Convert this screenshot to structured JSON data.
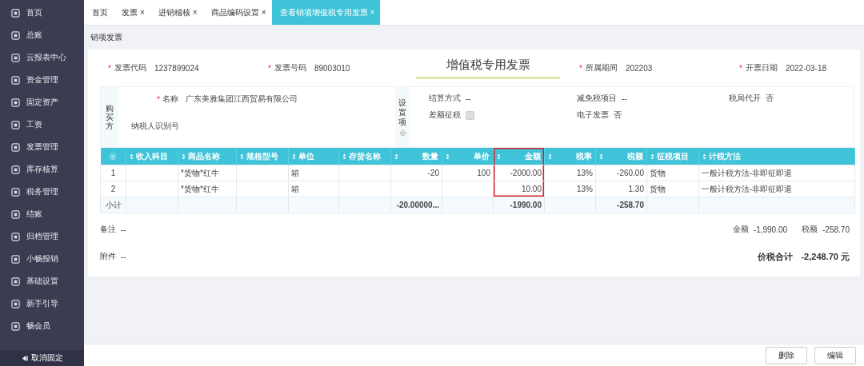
{
  "sidebar": {
    "items": [
      {
        "label": "首页"
      },
      {
        "label": "总账"
      },
      {
        "label": "云报表中心"
      },
      {
        "label": "资金管理"
      },
      {
        "label": "固定资产"
      },
      {
        "label": "工资"
      },
      {
        "label": "发票管理"
      },
      {
        "label": "库存核算"
      },
      {
        "label": "税务管理"
      },
      {
        "label": "结账"
      },
      {
        "label": "归档管理"
      },
      {
        "label": "小畅报销"
      },
      {
        "label": "基础设置"
      },
      {
        "label": "新手引导"
      },
      {
        "label": "畅会员"
      }
    ],
    "unpin": "取消固定"
  },
  "tabs": [
    {
      "label": "首页",
      "selected": false
    },
    {
      "label": "发票",
      "close": "×",
      "selected": false
    },
    {
      "label": "进销稽核",
      "close": "×",
      "selected": false
    },
    {
      "label": "商品编码设置",
      "close": "×",
      "selected": false
    },
    {
      "label": "查看销项增值税专用发票",
      "close": "×",
      "selected": true
    }
  ],
  "page_title": "销项发票",
  "header_fields": [
    {
      "mark": "*",
      "label": "发票代码",
      "value": "1237899024"
    },
    {
      "mark": "*",
      "label": "发票号码",
      "value": "89003010"
    }
  ],
  "invoice_title": "增值税专用发票",
  "header_fields_right": [
    {
      "mark": "*",
      "label": "所属期间",
      "value": "202203"
    },
    {
      "mark": "*",
      "label": "开票日期",
      "value": "2022-03-18"
    }
  ],
  "buyer": {
    "section": "购买方",
    "name_mark": "*",
    "name_label": "名称",
    "name_value": "广东美雅集团江西贸易有限公司",
    "tax_id_label": "纳税人识别号"
  },
  "settings": {
    "section": "设置项",
    "settlement_label": "结算方式",
    "settlement_value": "--",
    "diff_tax_label": "差额征税",
    "diff_tax_checked": false,
    "exempt_label": "减免税项目",
    "exempt_value": "--",
    "e_invoice_label": "电子发票",
    "e_invoice_value": "否",
    "bureau_label": "税局代开",
    "bureau_value": "否"
  },
  "table": {
    "columns": [
      {
        "label": "收入科目",
        "highlighted": false
      },
      {
        "label": "商品名称",
        "highlighted": false
      },
      {
        "label": "规格型号",
        "highlighted": false
      },
      {
        "label": "单位",
        "highlighted": false
      },
      {
        "label": "存货名称",
        "highlighted": false
      },
      {
        "label": "数量",
        "highlighted": false
      },
      {
        "label": "单价",
        "highlighted": false
      },
      {
        "label": "金额",
        "highlighted": true
      },
      {
        "label": "税率",
        "highlighted": false
      },
      {
        "label": "税额",
        "highlighted": false
      },
      {
        "label": "征税项目",
        "highlighted": false
      },
      {
        "label": "计税方法",
        "highlighted": false
      }
    ],
    "rows": [
      {
        "index": "1",
        "cells": [
          "",
          "*货物*红牛",
          "",
          "箱",
          "",
          "-20",
          "100",
          "-2000.00",
          "13%",
          "-260.00",
          "货物",
          "一般计税方法-非即征即退"
        ]
      },
      {
        "index": "2",
        "cells": [
          "",
          "*货物*红牛",
          "",
          "箱",
          "",
          "",
          "",
          "10.00",
          "13%",
          "1.30",
          "货物",
          "一般计税方法-非即征即退"
        ]
      }
    ],
    "subtotal": {
      "label": "小计",
      "cells": [
        "",
        "",
        "",
        "",
        "",
        "-20.00000...",
        "",
        "-1990.00",
        "",
        "-258.70",
        "",
        ""
      ]
    }
  },
  "remark": {
    "label": "备注",
    "value": "--"
  },
  "attachment": {
    "label": "附件",
    "value": "--"
  },
  "amount": {
    "label": "金额",
    "value": "-1,990.00"
  },
  "tax": {
    "label": "税额",
    "value": "-258.70"
  },
  "grand_total": {
    "label": "价税合计",
    "value": "-2,248.70 元"
  },
  "buttons": [
    "删除",
    "编辑"
  ]
}
